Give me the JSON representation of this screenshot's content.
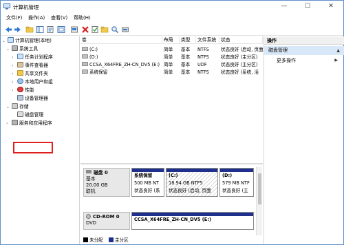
{
  "window": {
    "title": "计算机管理",
    "controls": {
      "minimize": "—",
      "maximize": "☐",
      "close": "✕"
    }
  },
  "menu": [
    "文件(F)",
    "操作(A)",
    "查看(V)",
    "帮助(H)"
  ],
  "tree": {
    "items": [
      {
        "label": "计算机管理(本地)",
        "level": 0
      },
      {
        "label": "系统工具",
        "level": 1
      },
      {
        "label": "任务计划程序",
        "level": 2
      },
      {
        "label": "事件查看器",
        "level": 2
      },
      {
        "label": "共享文件夹",
        "level": 2
      },
      {
        "label": "本地用户和组",
        "level": 2
      },
      {
        "label": "性能",
        "level": 2
      },
      {
        "label": "设备管理器",
        "level": 2
      },
      {
        "label": "存储",
        "level": 1
      },
      {
        "label": "磁盘管理",
        "level": 2
      },
      {
        "label": "服务和应用程序",
        "level": 1
      }
    ]
  },
  "volumes": {
    "headers": [
      "卷",
      "布局",
      "类型",
      "文件系统",
      "状态"
    ],
    "rows": [
      {
        "name": "(C:)",
        "layout": "简单",
        "type": "基本",
        "fs": "NTFS",
        "status": "状态良好 (启动, 页面"
      },
      {
        "name": "(D:)",
        "layout": "简单",
        "type": "基本",
        "fs": "NTFS",
        "status": "状态良好 (主分区)"
      },
      {
        "name": "CCSA_X64FRE_ZH-CN_DV5 (E:)",
        "layout": "简单",
        "type": "基本",
        "fs": "UDF",
        "status": "状态良好 (主分区)"
      },
      {
        "name": "系统保留",
        "layout": "简单",
        "type": "基本",
        "fs": "NTFS",
        "status": "状态良好 (系统, 活"
      }
    ]
  },
  "disks": [
    {
      "label": {
        "name": "磁盘 0",
        "kind": "基本",
        "size": "20.00 GB",
        "state": "联机"
      },
      "partitions": [
        {
          "name": "系统保留",
          "size": "500 MB NT",
          "status": "状态良好 (系"
        },
        {
          "name": "(C:)",
          "size": "18.94 GB NTFS",
          "status": "状态良好 (启动, 页面"
        },
        {
          "name": "(D:)",
          "size": "579 MB NTF",
          "status": "状态良好 (主"
        }
      ]
    },
    {
      "label": {
        "name": "CD-ROM 0",
        "kind": "DVD"
      },
      "partitions": [
        {
          "name": "CCSA_X64FRE_ZH-CN_DV5 (E:)"
        }
      ]
    }
  ],
  "legend": [
    {
      "label": "未分配",
      "color": "#000000"
    },
    {
      "label": "主分区",
      "color": "#1e2f8c"
    }
  ],
  "actions": {
    "header": "操作",
    "selected": "磁盘管理",
    "more": "更多操作"
  },
  "colors": {
    "partition_bar": "#1e2f8c",
    "selection": "#d9e8f8",
    "annotation": "#e02020"
  }
}
